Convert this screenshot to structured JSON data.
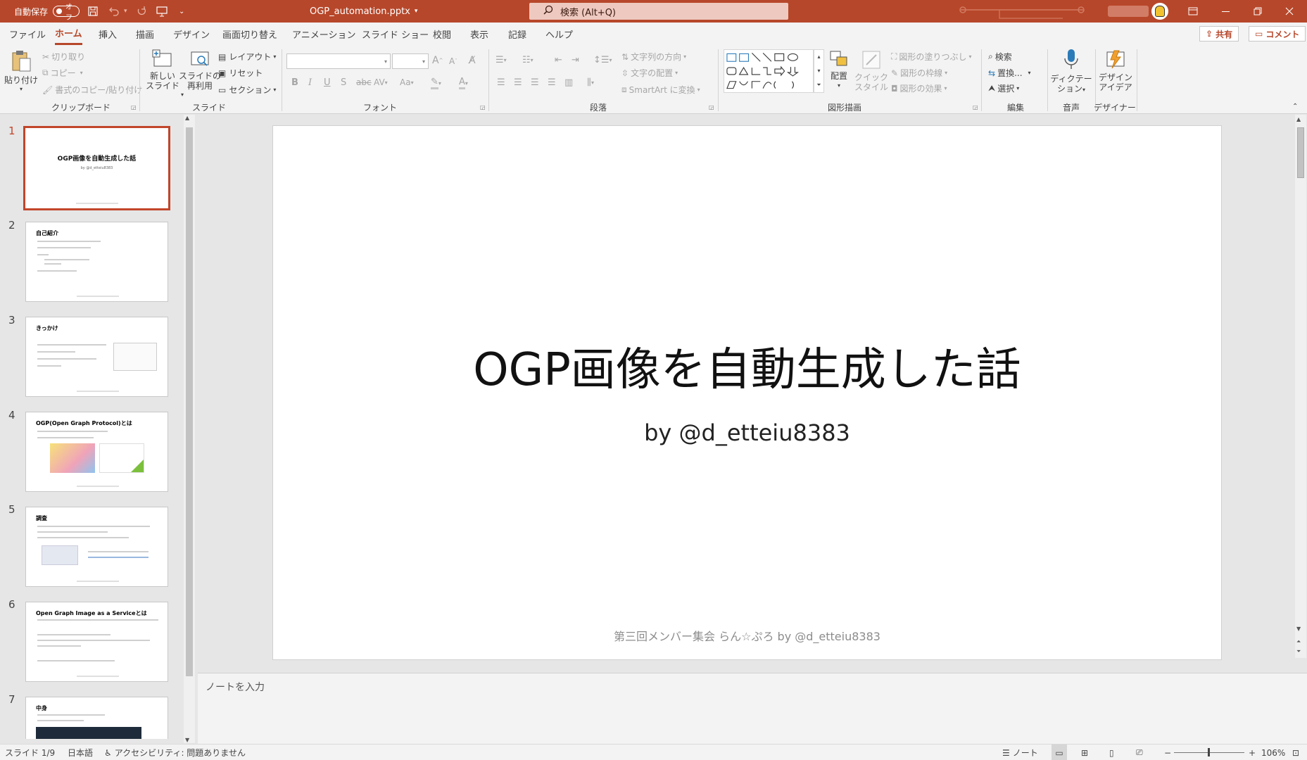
{
  "titlebar": {
    "autosave_label": "自動保存",
    "autosave_state": "オフ",
    "filename": "OGP_automation.pptx",
    "search_placeholder": "検索 (Alt+Q)"
  },
  "menu": {
    "tabs": [
      "ファイル",
      "ホーム",
      "挿入",
      "描画",
      "デザイン",
      "画面切り替え",
      "アニメーション",
      "スライド ショー",
      "校閲",
      "表示",
      "記録",
      "ヘルプ"
    ],
    "share_label": "共有",
    "comment_label": "コメント"
  },
  "ribbon": {
    "clipboard": {
      "paste": "貼り付け",
      "cut": "切り取り",
      "copy": "コピー",
      "format_painter": "書式のコピー/貼り付け",
      "group": "クリップボード"
    },
    "slides": {
      "new_slide_1": "新しい",
      "new_slide_2": "スライド",
      "reuse_1": "スライドの",
      "reuse_2": "再利用",
      "layout": "レイアウト",
      "reset": "リセット",
      "section": "セクション",
      "group": "スライド"
    },
    "font": {
      "group": "フォント"
    },
    "paragraph": {
      "text_direction": "文字列の方向",
      "align_text": "文字の配置",
      "smartart": "SmartArt に変換",
      "group": "段落"
    },
    "drawing": {
      "arrange": "配置",
      "quick_styles_1": "クイック",
      "quick_styles_2": "スタイル",
      "shape_fill": "図形の塗りつぶし",
      "shape_outline": "図形の枠線",
      "shape_effects": "図形の効果",
      "group": "図形描画"
    },
    "editing": {
      "find": "検索",
      "replace": "置換...",
      "select": "選択",
      "group": "編集"
    },
    "voice": {
      "dictate_1": "ディクテー",
      "dictate_2": "ション",
      "group": "音声"
    },
    "designer": {
      "ideas_1": "デザイン",
      "ideas_2": "アイデア",
      "group": "デザイナー"
    }
  },
  "thumbnails": [
    {
      "num": "1",
      "title": "OGP画像を自動生成した話",
      "subtitle": "by @d_etteiu8383"
    },
    {
      "num": "2",
      "title": "自己紹介"
    },
    {
      "num": "3",
      "title": "きっかけ"
    },
    {
      "num": "4",
      "title": "OGP(Open Graph Protocol)とは"
    },
    {
      "num": "5",
      "title": "調査"
    },
    {
      "num": "6",
      "title": "Open Graph Image as a Serviceとは"
    },
    {
      "num": "7",
      "title": "中身"
    }
  ],
  "slide": {
    "title": "OGP画像を自動生成した話",
    "subtitle": "by @d_etteiu8383",
    "footer": "第三回メンバー集会 らん☆ぷろ by @d_etteiu8383"
  },
  "notes": {
    "placeholder": "ノートを入力"
  },
  "statusbar": {
    "slide_info": "スライド 1/9",
    "language": "日本語",
    "accessibility": "アクセシビリティ: 問題ありません",
    "notes_label": "ノート",
    "zoom": "106%"
  },
  "colors": {
    "accent": "#b7472a",
    "selected_thumb": "#c1462a"
  }
}
